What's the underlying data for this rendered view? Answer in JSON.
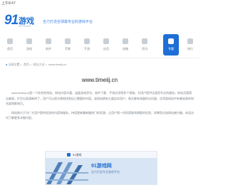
{
  "status_bar": {
    "time": "上午8:47"
  },
  "header": {
    "logo_number": "91",
    "logo_text": "游戏",
    "logo_sub": "91YOUXI",
    "slogan": "全力打造全球最专业的游戏平台"
  },
  "nav": {
    "items": [
      {
        "label": "首页",
        "icon": "home-icon",
        "active": false
      },
      {
        "label": "游戏",
        "icon": "gamepad-icon",
        "active": false
      },
      {
        "label": "软件",
        "icon": "apps-icon",
        "active": false
      },
      {
        "label": "苹果",
        "icon": "apple-icon",
        "active": false
      },
      {
        "label": "手游",
        "icon": "phone-icon",
        "active": false
      },
      {
        "label": "应用",
        "icon": "grid-icon",
        "active": false
      },
      {
        "label": "攻略",
        "icon": "book-icon",
        "active": false
      },
      {
        "label": "资讯",
        "icon": "news-icon",
        "active": false
      },
      {
        "label": "专题",
        "icon": "article-icon",
        "active": true
      },
      {
        "label": "排行",
        "icon": "rank-icon",
        "active": false
      }
    ]
  },
  "breadcrumb": {
    "icon": "location-icon",
    "items": [
      "当前位置",
      "首页",
      "网址大全",
      "www.timeiij.cn"
    ]
  },
  "site_url": "www.timeiij.cn",
  "article": {
    "paragraphs": [
      "www.timeiij.cn是一个综合性网站，网站内容丰富，涵盖游戏资讯、软件下载、手机应用等多个领域，为用户提供全面而专业的服务。网站页面简洁美观，栏目分类清晰明了，用户可以很方便地找到自己需要的内容。该网站拥有大量忠实用户，每天都有海量的访问量，在同类网站中有着较高的知名度和影响力。",
      "网站致力于为广大用户提供优质的内容和服务，持续更新最新最热门的资源，让用户第一时间获取到想要的信息。如果您对该网站感兴趣，欢迎访问了解更多详细内容。"
    ]
  },
  "banner": {
    "site_title": "91游戏",
    "headline": "91游戏网",
    "subline": "全力打造专业游戏平台"
  },
  "colors": {
    "brand_blue": "#1e6fd6",
    "nav_active_bg": "#1e6fd6"
  }
}
